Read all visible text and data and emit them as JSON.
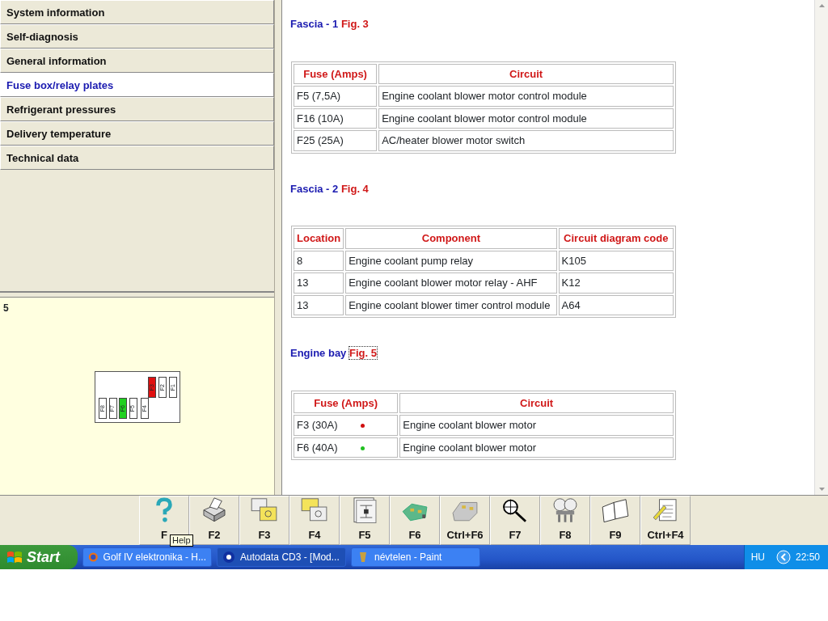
{
  "menu": [
    {
      "label": "System information",
      "selected": false
    },
    {
      "label": "Self-diagnosis",
      "selected": false
    },
    {
      "label": "General information",
      "selected": false
    },
    {
      "label": "Fuse box/relay plates",
      "selected": true
    },
    {
      "label": "Refrigerant pressures",
      "selected": false
    },
    {
      "label": "Delivery temperature",
      "selected": false
    },
    {
      "label": "Technical data",
      "selected": false
    }
  ],
  "preview": {
    "number": "5",
    "fuses_top": [
      {
        "label": "F3",
        "color": "#e01010"
      },
      {
        "label": "F2",
        "color": "#ffffff"
      },
      {
        "label": "F1",
        "color": "#ffffff"
      }
    ],
    "fuses_bottom": [
      {
        "label": "F8",
        "color": "#ffffff"
      },
      {
        "label": "F7",
        "color": "#ffffff"
      },
      {
        "label": "F6",
        "color": "#20d020"
      },
      {
        "label": "F5",
        "color": "#ffffff"
      },
      {
        "label": "F4",
        "color": "#ffffff"
      }
    ]
  },
  "sections": [
    {
      "title": "Fascia - 1",
      "figure": "Fig. 3",
      "focused": false,
      "columns": [
        "Fuse (Amps)",
        "Circuit"
      ],
      "rows": [
        {
          "cells": [
            "F5 (7,5A)",
            "Engine coolant blower motor control module"
          ]
        },
        {
          "cells": [
            "F16 (10A)",
            "Engine coolant blower motor control module"
          ]
        },
        {
          "cells": [
            "F25 (25A)",
            "AC/heater blower motor switch"
          ]
        }
      ]
    },
    {
      "title": "Fascia - 2",
      "figure": "Fig. 4",
      "focused": false,
      "columns": [
        "Location",
        "Component",
        "Circuit diagram code"
      ],
      "rows": [
        {
          "cells": [
            "8",
            "Engine coolant pump relay",
            "K105"
          ]
        },
        {
          "cells": [
            "13",
            "Engine coolant blower motor relay - AHF",
            "K12"
          ]
        },
        {
          "cells": [
            "13",
            "Engine coolant blower timer control module",
            "A64"
          ]
        }
      ]
    },
    {
      "title": "Engine bay",
      "figure": "Fig. 5",
      "focused": true,
      "columns": [
        "Fuse (Amps)",
        "Circuit"
      ],
      "rows": [
        {
          "cells": [
            "F3 (30A)",
            "Engine coolant blower motor"
          ],
          "color": "#d01010"
        },
        {
          "cells": [
            "F6 (40A)",
            "Engine coolant blower motor"
          ],
          "color": "#20c020"
        }
      ]
    }
  ],
  "toolbar": [
    {
      "label": "F",
      "kind": "help"
    },
    {
      "label": "F2",
      "kind": "print"
    },
    {
      "label": "F3",
      "kind": "docs"
    },
    {
      "label": "F4",
      "kind": "docs2"
    },
    {
      "label": "F5",
      "kind": "diagram"
    },
    {
      "label": "F6",
      "kind": "board"
    },
    {
      "label": "Ctrl+F6",
      "kind": "part"
    },
    {
      "label": "F7",
      "kind": "search"
    },
    {
      "label": "F8",
      "kind": "gauges"
    },
    {
      "label": "F9",
      "kind": "book"
    },
    {
      "label": "Ctrl+F4",
      "kind": "notes"
    }
  ],
  "tooltip": "Help",
  "taskbar": {
    "start": "Start",
    "tasks": [
      {
        "label": "Golf IV elektronika - H...",
        "selected": false
      },
      {
        "label": "Autodata CD3 - [Mod...",
        "selected": true
      },
      {
        "label": "névtelen - Paint",
        "selected": false
      }
    ],
    "lang": "HU",
    "time": "22:50"
  }
}
